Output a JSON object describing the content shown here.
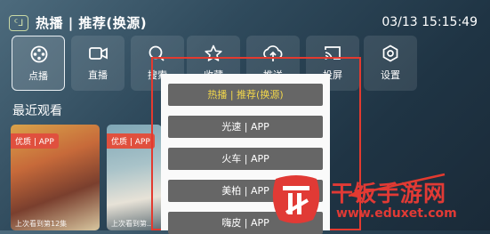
{
  "header": {
    "logo_text": "ᑦᒧ",
    "title": "热播 | 推荐(换源)",
    "clock": "03/13 15:15:49"
  },
  "nav": [
    {
      "label": "点播",
      "icon": "film-reel-icon"
    },
    {
      "label": "直播",
      "icon": "video-camera-icon"
    },
    {
      "label": "搜索",
      "icon": "search-icon"
    },
    {
      "label": "收藏",
      "icon": "star-icon"
    },
    {
      "label": "推送",
      "icon": "cloud-upload-icon"
    },
    {
      "label": "投屏",
      "icon": "cast-icon"
    },
    {
      "label": "设置",
      "icon": "gear-icon"
    }
  ],
  "recent": {
    "title": "最近观看",
    "items": [
      {
        "tag": "优质 | APP",
        "caption": "上次看到第12集"
      },
      {
        "tag": "优质 | APP",
        "caption": "上次看到第..."
      }
    ]
  },
  "popup": {
    "options": [
      "热播 | 推荐(换源)",
      "光速 | APP",
      "火车 | APP",
      "美柏 | APP",
      "嗨皮 | APP"
    ]
  },
  "watermark": {
    "name": "干饭手游网",
    "url": "www.eduxet.com",
    "color": "#e13a35"
  }
}
